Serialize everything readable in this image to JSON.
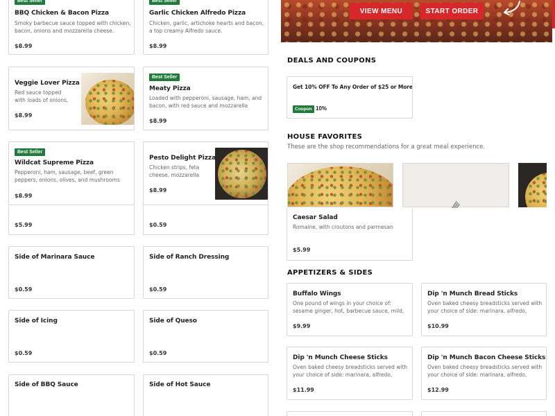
{
  "common": {
    "best_seller": "Best Seller"
  },
  "left_items": [
    {
      "name": "BBQ Chicken & Bacon Pizza",
      "desc": "Smoky barbecue sauce topped with chicken, bacon, onions and mozzarella cheese.",
      "price": "$8.99"
    },
    {
      "name": "Garlic Chicken Alfredo Pizza",
      "desc": "Chicken, garlic, artichoke hearts and bacon, a top creamy Alfredo sauce.",
      "price": "$8.99"
    },
    {
      "name": "Veggie Lover Pizza",
      "desc": "Red sauce topped with loads of onions, green…",
      "price": "$8.99"
    },
    {
      "name": "Meaty Pizza",
      "desc": "Loaded with pepperoni, sausage, ham, and bacon, with red sauce and mozzarella cheese.",
      "price": "$8.99"
    },
    {
      "name": "Wildcat Supreme Pizza",
      "desc": "Pepperoni, ham, sausage, beef, green peppers, onions, olives, and mushrooms piled on red sau…",
      "price": "$8.99"
    },
    {
      "name": "Pesto Delight Pizza",
      "desc": "Chicken strips, feta cheese, mozzarella chees…",
      "price": "$8.99"
    },
    {
      "name": "",
      "desc": "",
      "price": "$5.99"
    },
    {
      "name": "",
      "desc": "",
      "price": "$0.59"
    },
    {
      "name": "Side of Marinara Sauce",
      "desc": "",
      "price": "$0.59"
    },
    {
      "name": "Side of Ranch Dressing",
      "desc": "",
      "price": "$0.59"
    },
    {
      "name": "Side of Icing",
      "desc": "",
      "price": "$0.59"
    },
    {
      "name": "Side of Queso",
      "desc": "",
      "price": "$0.59"
    },
    {
      "name": "Side of BBQ Sauce",
      "desc": "",
      "price": ""
    },
    {
      "name": "Side of Hot Sauce",
      "desc": "",
      "price": ""
    }
  ],
  "hero": {
    "view_menu": "VIEW MENU",
    "start_order": "START ORDER"
  },
  "deals": {
    "title": "DEALS AND COUPONS",
    "coupon_title": "Get 10% OFF To Any Order of $25 or More",
    "coupon_label": "Coupon",
    "coupon_value": "10%"
  },
  "favorites": {
    "title": "HOUSE FAVORITES",
    "subtitle": "These are the shop recommendations for a great meal experience.",
    "card": {
      "name": "Caesar Salad",
      "desc": "Romaine, with croutons and parmesan cheese.",
      "price": "$5.99"
    }
  },
  "appetizers": {
    "title": "APPETIZERS & SIDES",
    "items": [
      {
        "name": "Buffalo Wings",
        "desc": "One pound of wings in your choice of: sesame ginger, hot, barbecue sauce, mild, parmesan…",
        "price": "$9.99"
      },
      {
        "name": "Dip 'n Munch Bread Sticks",
        "desc": "Oven baked cheesy breadsticks served with your choice of side: marinara, alfredo, queso, ranch.",
        "price": "$10.99"
      },
      {
        "name": "Dip 'n Munch Cheese Sticks",
        "desc": "Oven baked cheesy breadsticks served with your choice of side: marinara, alfredo, queso, blue…",
        "price": "$11.99"
      },
      {
        "name": "Dip 'n Munch Bacon Cheese Sticks",
        "desc": "Oven baked cheesy breadsticks served with your choice of side: marinara, alfredo, queso, blue…",
        "price": "$12.99"
      }
    ]
  },
  "colors": {
    "accent_red": "#d6272b",
    "badge_green": "#1f7a3b"
  },
  "icons": {
    "arrow": "curved-arrow-icon",
    "fork": "fork-icon"
  }
}
